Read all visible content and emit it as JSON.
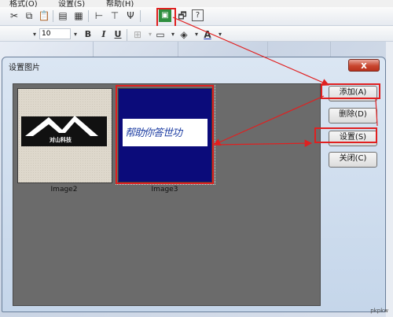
{
  "menubar": {
    "items": [
      "格式(O)",
      "设置(S)",
      "帮助(H)"
    ]
  },
  "toolbar": {
    "font_size": "10",
    "bold": "B",
    "italic": "I",
    "underline": "U",
    "font_color_glyph": "A"
  },
  "dialog": {
    "title": "设置图片",
    "close_glyph": "x",
    "images": [
      {
        "caption": "Image2",
        "logo_text": "对山科技"
      },
      {
        "caption": "Image3",
        "signature_text": "帮助你答世功"
      }
    ],
    "buttons": {
      "add": "添加(A)",
      "delete": "删除(D)",
      "set": "设置(S)",
      "close": "关闭(C)"
    }
  },
  "watermark": "pkpkw"
}
